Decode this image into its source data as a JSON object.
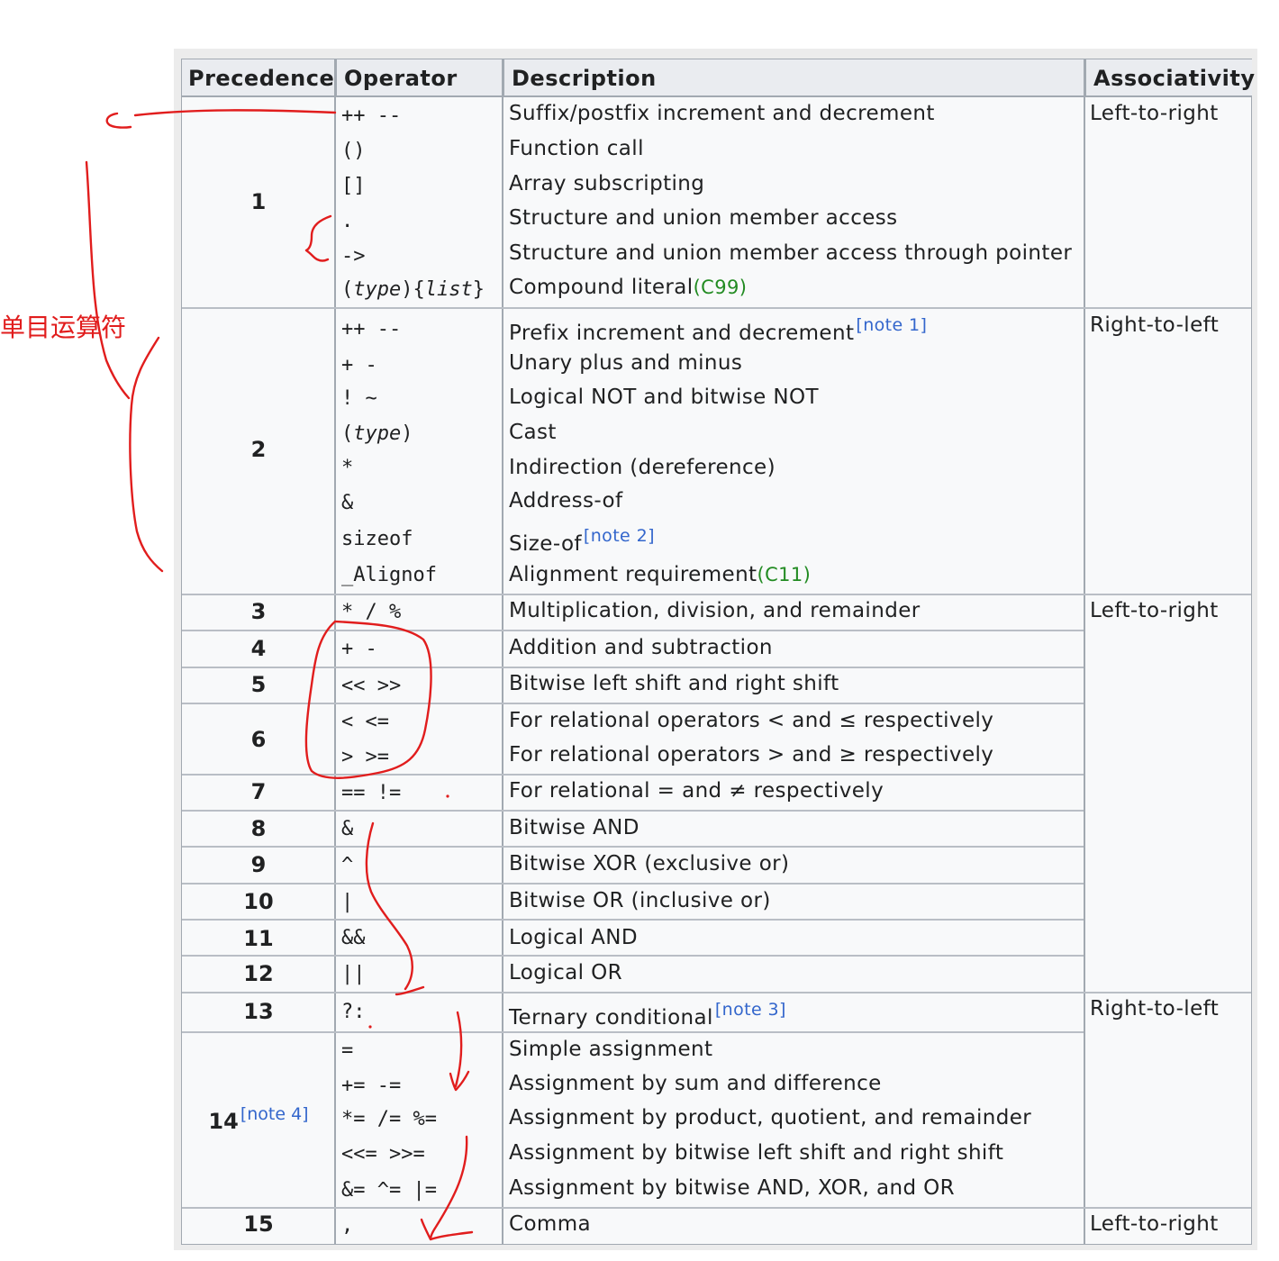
{
  "table": {
    "headers": {
      "precedence": "Precedence",
      "operator": "Operator",
      "description": "Description",
      "associativity": "Associativity"
    },
    "rows": [
      {
        "prec": "1",
        "operators": [
          "++ --",
          "()",
          "[]",
          ".",
          "->",
          "(type){list}"
        ],
        "descriptions": [
          "Suffix/postfix increment and decrement",
          "Function call",
          "Array subscripting",
          "Structure and union member access",
          "Structure and union member access through pointer",
          "Compound literal"
        ],
        "assoc": "Left-to-right"
      },
      {
        "prec": "2",
        "operators": [
          "++ --",
          "+ -",
          "! ~",
          "(type)",
          "*",
          "&",
          "sizeof",
          "_Alignof"
        ],
        "descriptions": [
          "Prefix increment and decrement",
          "Unary plus and minus",
          "Logical NOT and bitwise NOT",
          "Cast",
          "Indirection (dereference)",
          "Address-of",
          "Size-of",
          "Alignment requirement"
        ],
        "assoc": "Right-to-left"
      },
      {
        "prec": "3",
        "operators": [
          "* / %"
        ],
        "descriptions": [
          "Multiplication, division, and remainder"
        ],
        "assoc": "Left-to-right"
      },
      {
        "prec": "4",
        "operators": [
          "+ -"
        ],
        "descriptions": [
          "Addition and subtraction"
        ]
      },
      {
        "prec": "5",
        "operators": [
          "<< >>"
        ],
        "descriptions": [
          "Bitwise left shift and right shift"
        ]
      },
      {
        "prec": "6",
        "operators": [
          "< <=",
          "> >="
        ],
        "descriptions": [
          "For relational operators < and ≤ respectively",
          "For relational operators > and ≥ respectively"
        ]
      },
      {
        "prec": "7",
        "operators": [
          "== !="
        ],
        "descriptions": [
          "For relational = and ≠ respectively"
        ]
      },
      {
        "prec": "8",
        "operators": [
          "&"
        ],
        "descriptions": [
          "Bitwise AND"
        ]
      },
      {
        "prec": "9",
        "operators": [
          "^"
        ],
        "descriptions": [
          "Bitwise XOR (exclusive or)"
        ]
      },
      {
        "prec": "10",
        "operators": [
          "|"
        ],
        "descriptions": [
          "Bitwise OR (inclusive or)"
        ]
      },
      {
        "prec": "11",
        "operators": [
          "&&"
        ],
        "descriptions": [
          "Logical AND"
        ]
      },
      {
        "prec": "12",
        "operators": [
          "||"
        ],
        "descriptions": [
          "Logical OR"
        ]
      },
      {
        "prec": "13",
        "operators": [
          "?:"
        ],
        "descriptions": [
          "Ternary conditional"
        ],
        "assoc": "Right-to-left"
      },
      {
        "prec": "14",
        "operators": [
          "=",
          "+= -=",
          "*= /= %=",
          "<<= >>=",
          "&= ^= |="
        ],
        "descriptions": [
          "Simple assignment",
          "Assignment by sum and difference",
          "Assignment by product, quotient, and remainder",
          "Assignment by bitwise left shift and right shift",
          "Assignment by bitwise AND, XOR, and OR"
        ]
      },
      {
        "prec": "15",
        "operators": [
          ","
        ],
        "descriptions": [
          "Comma"
        ],
        "assoc": "Left-to-right"
      }
    ],
    "op_parts": {
      "type": "type",
      "list": "list",
      "paren_open": "(",
      "paren_close": ")",
      "brace_open": "{",
      "brace_close": "}"
    },
    "notes": {
      "note1": "[note 1]",
      "note2": "[note 2]",
      "note3": "[note 3]",
      "note4": "[note 4]"
    },
    "standards": {
      "c99": "(C99)",
      "c11": "(C11)"
    }
  },
  "annotation": {
    "label": "单目运算符",
    "color": "#e11d1d"
  }
}
